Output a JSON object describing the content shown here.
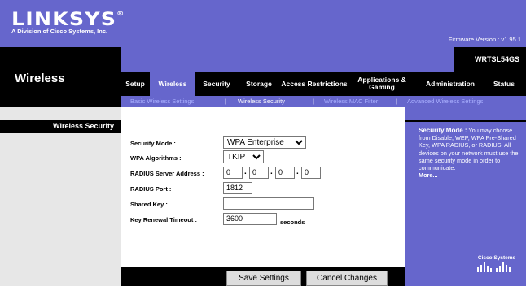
{
  "header": {
    "logo_text": "LINKSYS",
    "logo_reg": "®",
    "logo_sub": "A Division of Cisco Systems, Inc.",
    "firmware": "Firmware Version : v1.95.1"
  },
  "model": "WRTSL54GS",
  "section_title": "Wireless",
  "tabs": [
    "Setup",
    "Wireless",
    "Security",
    "Storage",
    "Access Restrictions",
    "Applications & Gaming",
    "Administration",
    "Status"
  ],
  "active_tab": "Wireless",
  "subtabs": [
    "Basic Wireless Settings",
    "Wireless Security",
    "Wireless MAC Filter",
    "Advanced Wireless Settings"
  ],
  "active_subtab": "Wireless Security",
  "separator": "|",
  "left_label": "Wireless Security",
  "form": {
    "security_mode_label": "Security Mode :",
    "security_mode_value": "WPA Enterprise",
    "wpa_algorithms_label": "WPA Algorithms :",
    "wpa_algorithms_value": "TKIP",
    "radius_address_label": "RADIUS Server Address :",
    "radius_address": [
      "0",
      "0",
      "0",
      "0"
    ],
    "radius_port_label": "RADIUS Port :",
    "radius_port": "1812",
    "shared_key_label": "Shared Key :",
    "shared_key": "",
    "key_renewal_label": "Key Renewal Timeout :",
    "key_renewal": "3600",
    "key_renewal_unit": "seconds"
  },
  "help": {
    "title": "Security Mode :",
    "body": "You may choose from Disable, WEP, WPA Pre-Shared Key, WPA RADIUS, or RADIUS. All devices on your network must use the same security mode in order to communicate.",
    "more": "More..."
  },
  "cisco_logo": "Cisco Systems",
  "buttons": {
    "save": "Save Settings",
    "cancel": "Cancel Changes"
  },
  "colors": {
    "brand": "#6666cc",
    "dark": "#000000",
    "panel": "#e7e7e7"
  }
}
